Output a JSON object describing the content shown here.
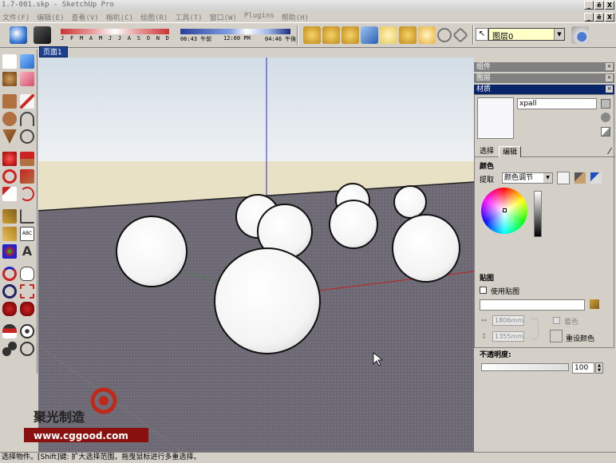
{
  "window": {
    "title": "1.7-001.skp - SketchUp Pro",
    "controls": [
      "_",
      "ē",
      "X"
    ]
  },
  "menu": {
    "items": [
      "文件(F)",
      "编辑(E)",
      "查看(V)",
      "相机(C)",
      "绘图(R)",
      "工具(T)",
      "窗口(W)",
      "Plugins",
      "帮助(H)"
    ]
  },
  "toolbar": {
    "months": [
      "J",
      "F",
      "M",
      "A",
      "M",
      "J",
      "J",
      "A",
      "S",
      "O",
      "N",
      "D"
    ],
    "time_start": "06:43 午前",
    "time_mid": "12:00 PM",
    "time_end": "04:46 午後",
    "layer_label": "图层0"
  },
  "scene": {
    "tab_label": "页面1"
  },
  "trays": {
    "components": "组件",
    "layers": "图层",
    "materials": "材质"
  },
  "materials": {
    "name": "xpall",
    "tab_select": "选择",
    "tab_edit": "编辑",
    "color_section": "颜色",
    "pick_label": "提取",
    "pick_value": "颜色调节",
    "texture_section": "贴图",
    "use_texture": "使用贴图",
    "width": "1806mm",
    "height": "1355mm",
    "colorize": "着色",
    "reset_color": "重设颜色",
    "opacity_label": "不透明度:",
    "opacity_value": "100"
  },
  "status": {
    "text": "选择物件。[Shift]键: 扩大选择范围，拖曳鼠标进行多重选择。"
  },
  "watermark": {
    "logo_text": "聚光制造",
    "url": "www.cggood.com"
  },
  "colors": {
    "sky": "#dfe6ec",
    "ground": "#6e6a74",
    "horizon": "#e8e0c4",
    "sphere": "#ffffff",
    "accent": "#0a246a"
  }
}
